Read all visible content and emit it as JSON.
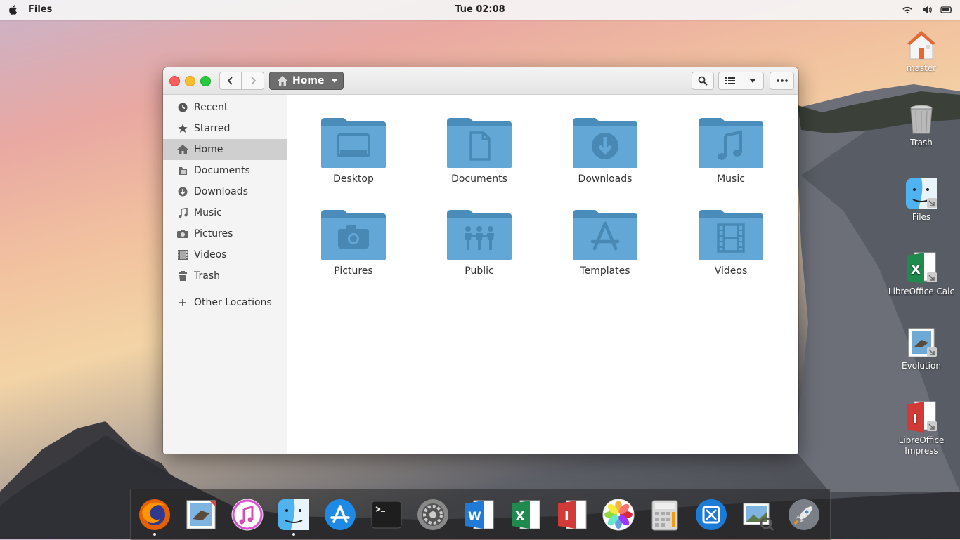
{
  "topbar": {
    "app_name": "Files",
    "clock": "Tue 02:08"
  },
  "desktop_icons": [
    {
      "label": "master",
      "icon": "home-folder-icon"
    },
    {
      "label": "Trash",
      "icon": "trash-icon"
    },
    {
      "label": "Files",
      "icon": "finder-icon"
    },
    {
      "label": "LibreOffice Calc",
      "icon": "libreoffice-calc-icon"
    },
    {
      "label": "Evolution",
      "icon": "evolution-mail-icon"
    },
    {
      "label": "LibreOffice Impress",
      "icon": "libreoffice-impress-icon"
    }
  ],
  "window": {
    "path_label": "Home"
  },
  "sidebar": {
    "items": [
      {
        "label": "Recent",
        "icon": "clock-icon"
      },
      {
        "label": "Starred",
        "icon": "star-icon"
      },
      {
        "label": "Home",
        "icon": "home-icon",
        "active": true
      },
      {
        "label": "Documents",
        "icon": "document-icon"
      },
      {
        "label": "Downloads",
        "icon": "download-icon"
      },
      {
        "label": "Music",
        "icon": "music-note-icon"
      },
      {
        "label": "Pictures",
        "icon": "camera-icon"
      },
      {
        "label": "Videos",
        "icon": "film-icon"
      },
      {
        "label": "Trash",
        "icon": "trash-icon"
      }
    ],
    "other_locations": "Other Locations"
  },
  "folders": [
    {
      "label": "Desktop",
      "icon": "desktop-folder-icon"
    },
    {
      "label": "Documents",
      "icon": "documents-folder-icon"
    },
    {
      "label": "Downloads",
      "icon": "downloads-folder-icon"
    },
    {
      "label": "Music",
      "icon": "music-folder-icon"
    },
    {
      "label": "Pictures",
      "icon": "pictures-folder-icon"
    },
    {
      "label": "Public",
      "icon": "public-folder-icon"
    },
    {
      "label": "Templates",
      "icon": "templates-folder-icon"
    },
    {
      "label": "Videos",
      "icon": "videos-folder-icon"
    }
  ],
  "dock": [
    {
      "name": "firefox-icon",
      "running": true
    },
    {
      "name": "mail-icon",
      "running": false
    },
    {
      "name": "itunes-icon",
      "running": false
    },
    {
      "name": "finder-icon",
      "running": true
    },
    {
      "name": "app-store-icon",
      "running": false
    },
    {
      "name": "terminal-icon",
      "running": false
    },
    {
      "name": "system-preferences-icon",
      "running": false
    },
    {
      "name": "word-icon",
      "running": false
    },
    {
      "name": "excel-icon",
      "running": false
    },
    {
      "name": "impress-icon",
      "running": false
    },
    {
      "name": "photos-icon",
      "running": false
    },
    {
      "name": "calculator-icon",
      "running": false
    },
    {
      "name": "xcode-icon",
      "running": false
    },
    {
      "name": "preview-icon",
      "running": false
    },
    {
      "name": "launchpad-icon",
      "running": false
    }
  ],
  "colors": {
    "folder_blue": "#5fa3d0",
    "folder_blue_dark": "#4a8cba",
    "sidebar_active": "#cfcfcf"
  }
}
